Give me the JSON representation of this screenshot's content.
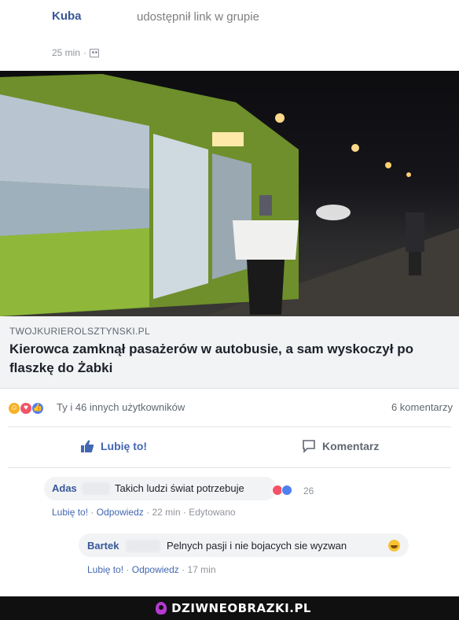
{
  "post": {
    "author": "Kuba",
    "share_text": "udostępnił link w grupie",
    "time": "25 min",
    "privacy_icon": "group-icon"
  },
  "photo": {
    "description_icon": "bus-night-photo",
    "colors": {
      "bus_green": "#7fae2a",
      "bus_gray": "#8a8c8a",
      "light": "#ffe9a8"
    }
  },
  "link": {
    "domain": "TWOJKURIEROLSZTYNSKI.PL",
    "title": "Kierowca zamknął pasażerów w autobusie, a sam wyskoczył po flaszkę do Żabki"
  },
  "reactions": {
    "icons": [
      "haha-icon",
      "love-icon",
      "like-icon"
    ],
    "summary": "Ty i 46 innych użytkowników",
    "comments": "6 komentarzy"
  },
  "actions": {
    "like": "Lubię to!",
    "comment": "Komentarz"
  },
  "comments": [
    {
      "name": "Adas",
      "text": "Takich ludzi świat potrzebuje",
      "reaction_count": "26",
      "like": "Lubię to!",
      "reply": "Odpowiedz",
      "time": "22 min",
      "edited": "Edytowano"
    },
    {
      "name": "Bartek",
      "text": "Pelnych pasji i nie bojacych sie wyzwan",
      "like": "Lubię to!",
      "reply": "Odpowiedz",
      "time": "17 min"
    }
  ],
  "watermark": {
    "text": "DZIWNEOBRAZKI.PL"
  },
  "colors": {
    "link_blue": "#365899",
    "action_blue": "#4267b2",
    "muted": "#90949c"
  }
}
